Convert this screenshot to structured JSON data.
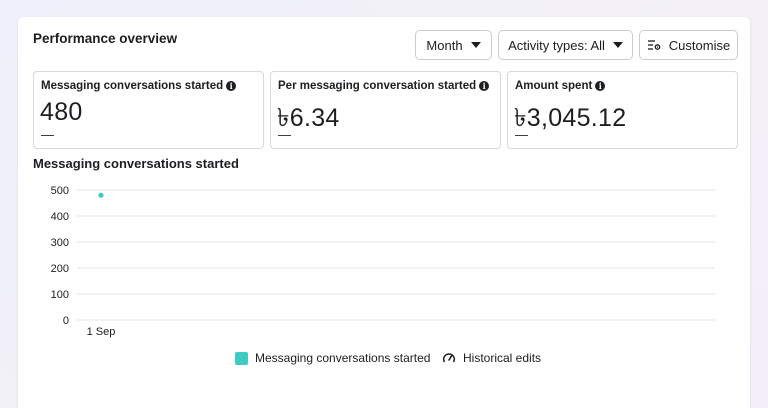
{
  "header": {
    "title": "Performance overview",
    "month_label": "Month",
    "activity_label": "Activity types: All",
    "customise_label": "Customise"
  },
  "metrics": [
    {
      "label": "Messaging conversations started",
      "value": "480",
      "delta": "—"
    },
    {
      "label": "Per messaging conversation started",
      "value": "৳6.34",
      "delta": "—"
    },
    {
      "label": "Amount spent",
      "value": "৳3,045.12",
      "delta": "—"
    }
  ],
  "chart": {
    "title": "Messaging conversations started",
    "legend_series": "Messaging conversations started",
    "legend_historical": "Historical edits"
  },
  "chart_data": {
    "type": "line",
    "title": "Messaging conversations started",
    "x": [
      "1 Sep"
    ],
    "series": [
      {
        "name": "Messaging conversations started",
        "values": [
          480
        ],
        "color": "#3ecbc1"
      }
    ],
    "yticks": [
      0,
      100,
      200,
      300,
      400,
      500
    ],
    "ylim": [
      0,
      500
    ],
    "xlabel": "",
    "ylabel": "",
    "grid": true,
    "legend_position": "bottom"
  },
  "colors": {
    "series": "#3ecbc1",
    "gridline": "#e4e6e9",
    "text": "#1c1e21"
  },
  "icons": {
    "dropdown": "caret-down-icon",
    "customise": "sliders-gear-icon",
    "info": "info-circle-icon",
    "historical": "gauge-pencil-icon"
  }
}
